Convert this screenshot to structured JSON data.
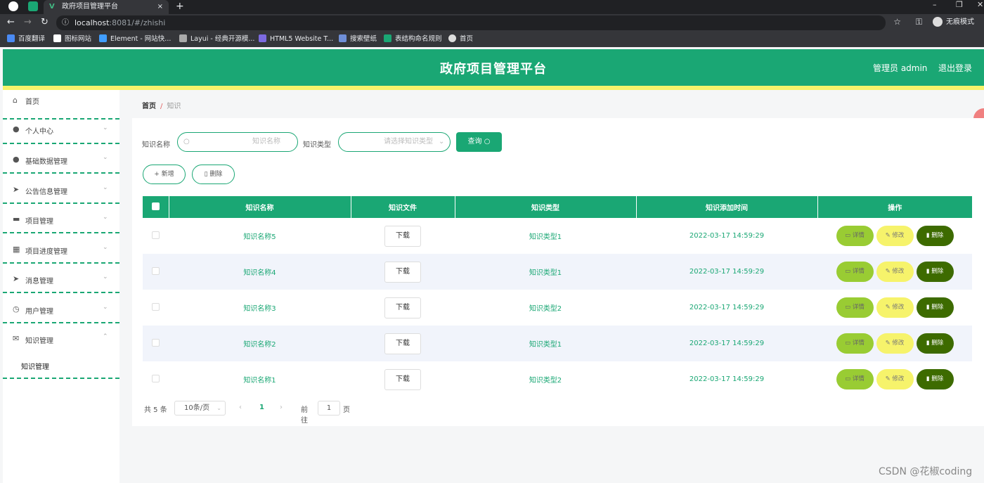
{
  "browser": {
    "tab_title": "政府项目管理平台",
    "tab_close": "×",
    "new_tab": "+",
    "url_host": "localhost",
    "url_rest": ":8081/#/zhishi",
    "incognito": "无痕模式",
    "bookmarks": [
      "百度翻译",
      "图标网站",
      "Element - 网站快...",
      "Layui - 经典开源模...",
      "HTML5 Website T...",
      "搜索壁纸",
      "表结构命名规则",
      "首页"
    ]
  },
  "header": {
    "title": "政府项目管理平台",
    "admin": "管理员 admin",
    "logout": "退出登录",
    "color": "#1aa774"
  },
  "sidebar": {
    "items": [
      {
        "label": "首页",
        "icon": "home-icon"
      },
      {
        "label": "个人中心",
        "icon": "user-icon"
      },
      {
        "label": "基础数据管理",
        "icon": "user-icon"
      },
      {
        "label": "公告信息管理",
        "icon": "send-icon"
      },
      {
        "label": "项目管理",
        "icon": "message-icon"
      },
      {
        "label": "项目进度管理",
        "icon": "calendar-icon"
      },
      {
        "label": "消息管理",
        "icon": "send-icon"
      },
      {
        "label": "用户管理",
        "icon": "clock-icon"
      },
      {
        "label": "知识管理",
        "icon": "mail-icon"
      }
    ],
    "submenu": "知识管理"
  },
  "breadcrumb": {
    "home": "首页",
    "sep": "/",
    "current": "知识"
  },
  "search": {
    "name_label": "知识名称",
    "name_placeholder": "知识名称",
    "type_label": "知识类型",
    "type_placeholder": "请选择知识类型",
    "query": "查询"
  },
  "actions": {
    "add": "新增",
    "delete": "删除"
  },
  "table": {
    "columns": [
      "知识名称",
      "知识文件",
      "知识类型",
      "知识添加时间",
      "操作"
    ],
    "download": "下载",
    "ops": {
      "detail": "详情",
      "edit": "修改",
      "delete": "删除"
    },
    "rows": [
      {
        "name": "知识名称5",
        "type": "知识类型1",
        "time": "2022-03-17 14:59:29"
      },
      {
        "name": "知识名称4",
        "type": "知识类型1",
        "time": "2022-03-17 14:59:29"
      },
      {
        "name": "知识名称3",
        "type": "知识类型2",
        "time": "2022-03-17 14:59:29"
      },
      {
        "name": "知识名称2",
        "type": "知识类型1",
        "time": "2022-03-17 14:59:29"
      },
      {
        "name": "知识名称1",
        "type": "知识类型2",
        "time": "2022-03-17 14:59:29"
      }
    ]
  },
  "pager": {
    "total": "共 5 条",
    "size": "10条/页",
    "page": "1",
    "goto": "前往",
    "goto_value": "1",
    "page_unit": "页"
  },
  "watermark": "CSDN @花椒coding"
}
